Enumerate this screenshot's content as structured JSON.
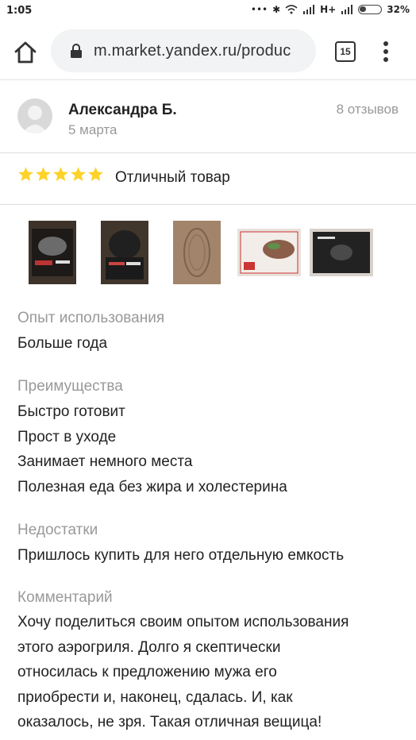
{
  "status_bar": {
    "time": "1:05",
    "network": "H+",
    "battery": "32%"
  },
  "browser": {
    "url": "m.market.yandex.ru/produc",
    "tab_count": "15"
  },
  "review": {
    "author": "Александра Б.",
    "date": "5 марта",
    "reviews_count": "8 отзывов",
    "rating": 5,
    "verdict": "Отличный товар",
    "photos_count": 5,
    "experience_label": "Опыт использования",
    "experience_value": "Больше года",
    "pros_label": "Преимущества",
    "pros": [
      "Быстро готовит",
      "Прост в уходе",
      "Занимает немного места",
      "Полезная еда без жира и холестерина"
    ],
    "cons_label": "Недостатки",
    "cons_value": "Пришлось купить для него отдельную емкость",
    "comment_label": "Комментарий",
    "comment_lines": [
      "Хочу поделиться своим опытом использования",
      "этого аэрогриля. Долго я скептически",
      "относилась к предложению мужа его",
      "приобрести и, наконец, сдалась. И, как",
      "оказалось, не зря.  Такая отличная вещица!"
    ]
  },
  "colors": {
    "star": "#fdd22b",
    "muted_text": "#999999",
    "url_bar_bg": "#f1f3f4"
  }
}
